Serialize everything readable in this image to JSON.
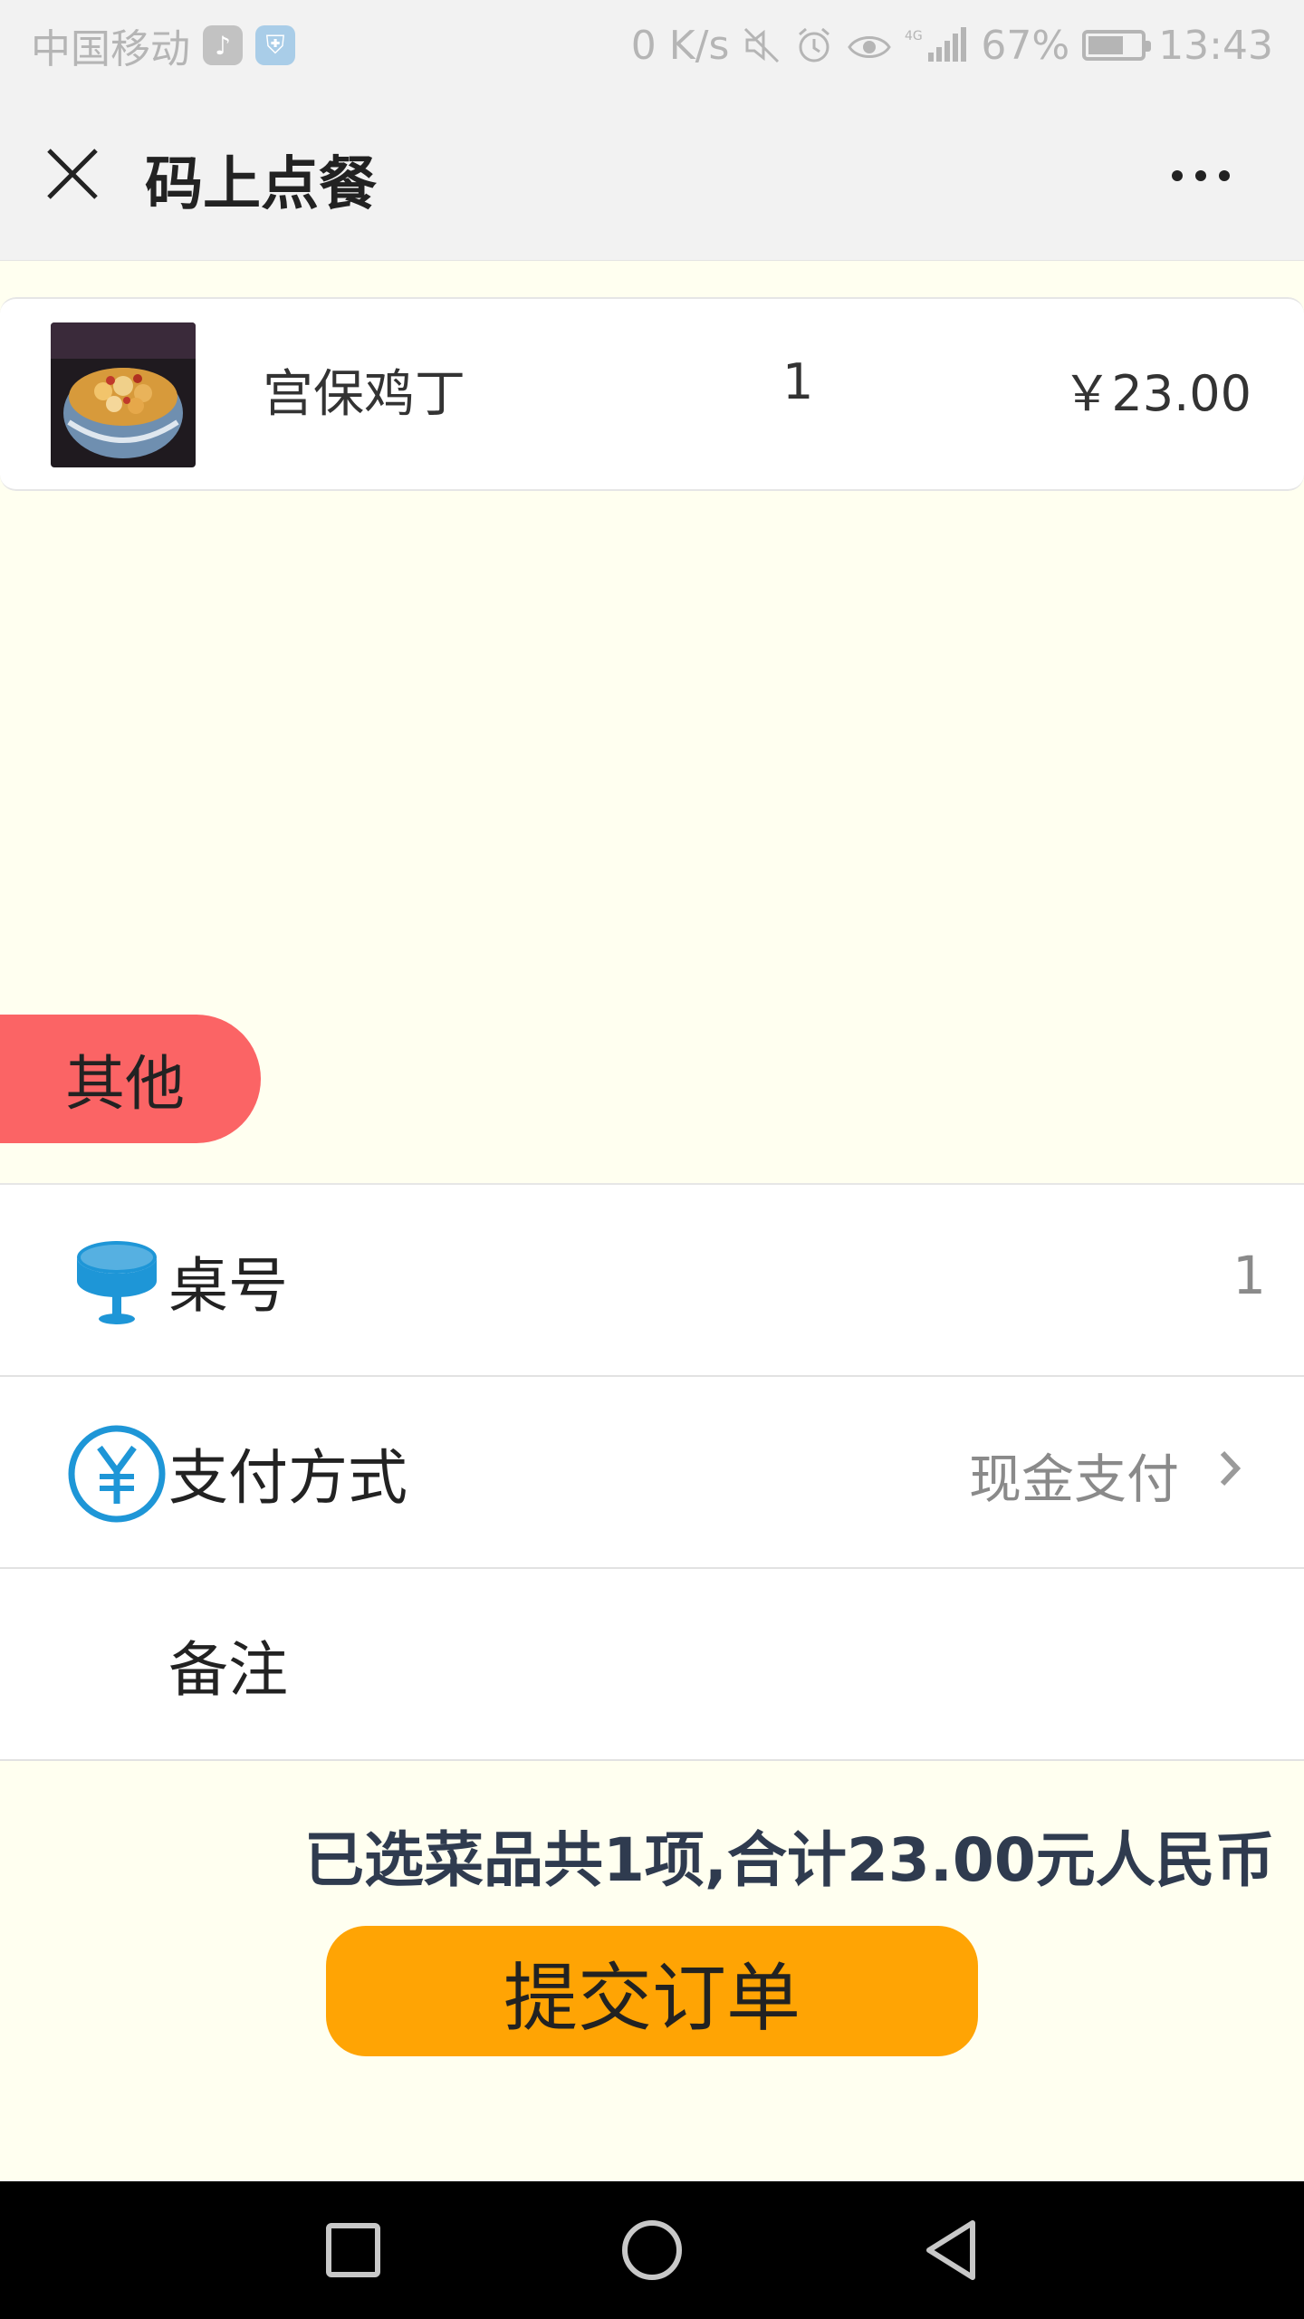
{
  "status_bar": {
    "carrier": "中国移动",
    "network_speed": "0 K/s",
    "signal_label": "4G",
    "battery": "67%",
    "battery_level": 0.67,
    "time": "13:43"
  },
  "header": {
    "title": "码上点餐",
    "close_icon": "close-icon",
    "more_icon": "more-icon"
  },
  "order": {
    "items": [
      {
        "name": "宫保鸡丁",
        "quantity": "1",
        "price": "￥23.00",
        "image_icon": "food-photo"
      }
    ]
  },
  "other_section": {
    "title": "其他"
  },
  "fields": {
    "table_number": {
      "label": "桌号",
      "value": "1",
      "icon": "table-icon"
    },
    "payment_method": {
      "label": "支付方式",
      "value": "现金支付",
      "icon": "yuan-icon"
    },
    "remark": {
      "label": "备注",
      "value": ""
    }
  },
  "summary": {
    "text": "已选菜品共1项,合计23.00元人民币"
  },
  "actions": {
    "submit_label": "提交订单"
  },
  "colors": {
    "accent_blue": "#1e96d7",
    "tab_red": "#fb6465",
    "button_orange": "#ffa404",
    "page_bg": "#fffff0",
    "summary_text": "#2f3b4f"
  }
}
